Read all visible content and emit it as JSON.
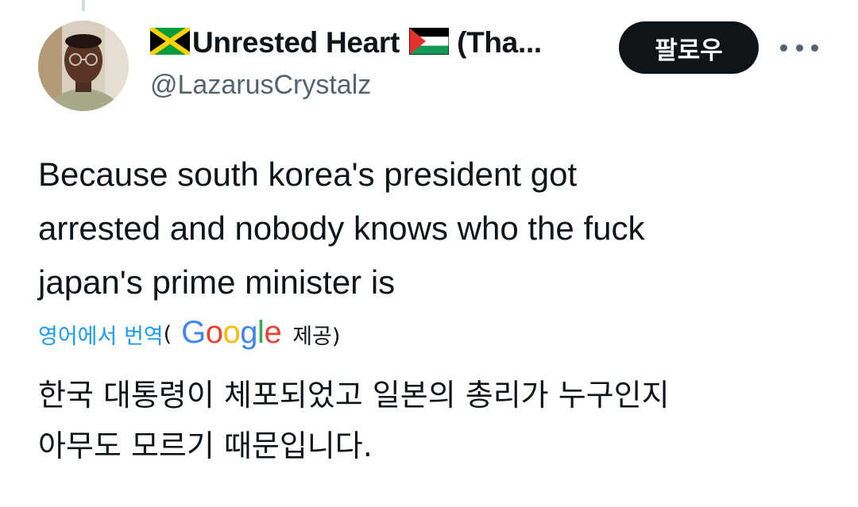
{
  "tweet": {
    "author": {
      "display_name": "Unrested Heart",
      "name_suffix": "(Tha...",
      "handle": "@LazarusCrystalz",
      "flag_left": "jamaica-flag-icon",
      "flag_right": "palestine-flag-icon"
    },
    "follow_label": "팔로우",
    "more_icon": "more-dots-icon",
    "text": "Because south korea's president got\narrested and nobody knows who the fuck\njapan's prime minister is",
    "translation": {
      "link_label": "영어에서 번역",
      "open_paren": "(",
      "google_letters": [
        "G",
        "o",
        "o",
        "g",
        "l",
        "e"
      ],
      "provided_label": "제공)",
      "text": "한국 대통령이 체포되었고 일본의 총리가 누구인지\n아무도 모르기 때문입니다."
    }
  },
  "colors": {
    "text_primary": "#0f1419",
    "text_secondary": "#536471",
    "link": "#1d9bf0",
    "follow_button_bg": "#0f1419",
    "google_blue": "#4285f4",
    "google_red": "#ea4335",
    "google_yellow": "#fbbc05",
    "google_green": "#34a853"
  }
}
